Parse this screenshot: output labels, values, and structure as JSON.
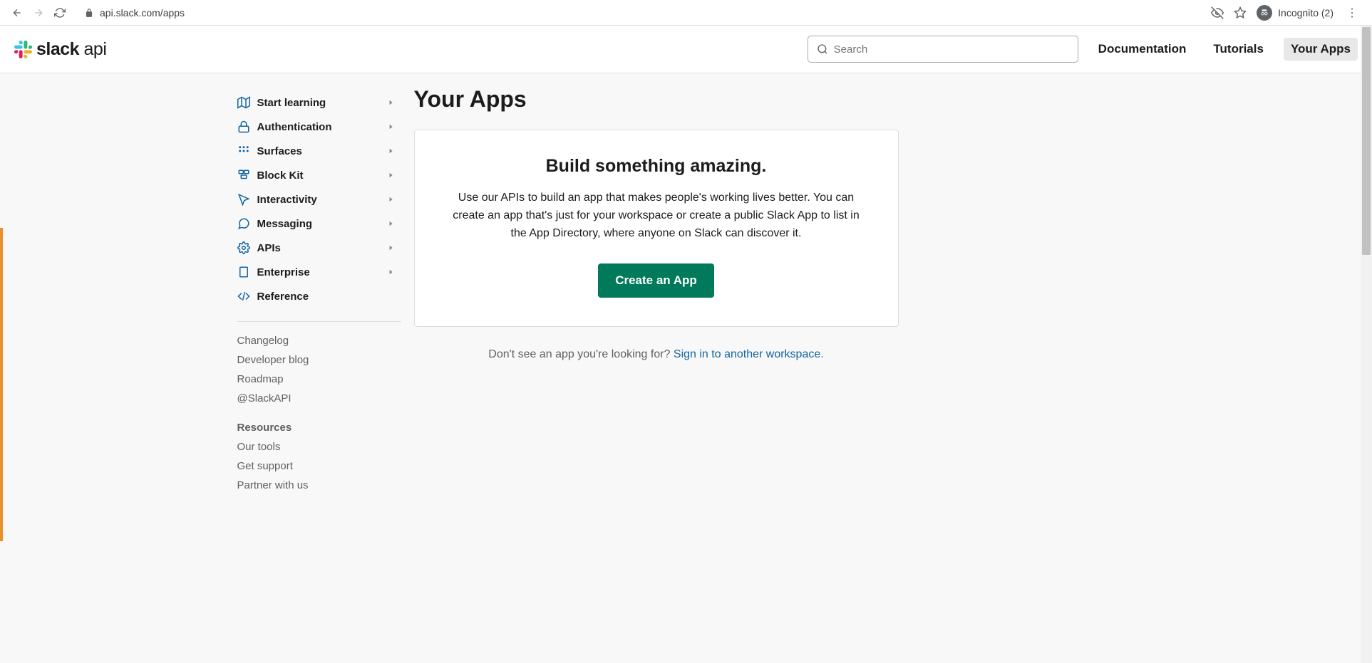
{
  "browser": {
    "url": "api.slack.com/apps",
    "incognito_label": "Incognito (2)"
  },
  "header": {
    "logo_bold": "slack",
    "logo_light": " api",
    "search_placeholder": "Search",
    "nav": {
      "documentation": "Documentation",
      "tutorials": "Tutorials",
      "your_apps": "Your Apps"
    }
  },
  "sidebar": {
    "items": [
      {
        "label": "Start learning"
      },
      {
        "label": "Authentication"
      },
      {
        "label": "Surfaces"
      },
      {
        "label": "Block Kit"
      },
      {
        "label": "Interactivity"
      },
      {
        "label": "Messaging"
      },
      {
        "label": "APIs"
      },
      {
        "label": "Enterprise"
      },
      {
        "label": "Reference"
      }
    ],
    "links": {
      "changelog": "Changelog",
      "developer_blog": "Developer blog",
      "roadmap": "Roadmap",
      "slack_api": "@SlackAPI"
    },
    "resources_heading": "Resources",
    "resources": {
      "our_tools": "Our tools",
      "get_support": "Get support",
      "partner": "Partner with us"
    }
  },
  "main": {
    "page_title": "Your Apps",
    "card_title": "Build something amazing.",
    "card_desc": "Use our APIs to build an app that makes people's working lives better. You can create an app that's just for your workspace or create a public Slack App to list in the App Directory, where anyone on Slack can discover it.",
    "create_btn": "Create an App",
    "signin_prompt": "Don't see an app you're looking for? ",
    "signin_link": "Sign in to another workspace",
    "signin_period": "."
  }
}
